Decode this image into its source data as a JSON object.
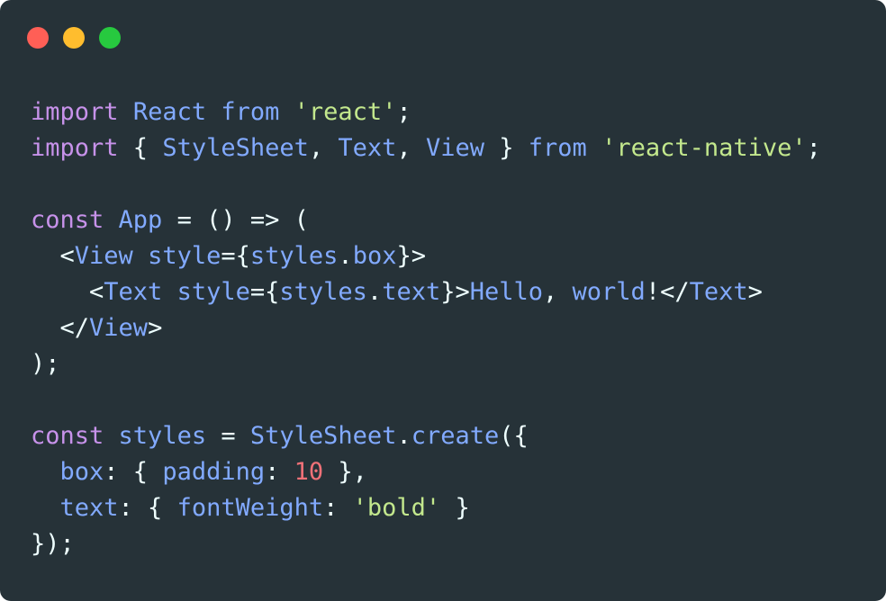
{
  "window": {
    "background": "#263238",
    "controls": [
      {
        "name": "close-button",
        "color": "#ff5f56"
      },
      {
        "name": "minimize-button",
        "color": "#ffbd2e"
      },
      {
        "name": "zoom-button",
        "color": "#27c93f"
      }
    ]
  },
  "theme": {
    "keyword": "#c792ea",
    "identifier": "#82aaff",
    "string": "#c3e88d",
    "number": "#f07178",
    "punctuation": "#eeffff"
  },
  "code": {
    "language": "jsx",
    "lines": [
      [
        [
          "keyword",
          "import"
        ],
        [
          "punct",
          " "
        ],
        [
          "ident",
          "React"
        ],
        [
          "punct",
          " "
        ],
        [
          "ident",
          "from"
        ],
        [
          "punct",
          " "
        ],
        [
          "string",
          "'react'"
        ],
        [
          "punct",
          ";"
        ]
      ],
      [
        [
          "keyword",
          "import"
        ],
        [
          "punct",
          " { "
        ],
        [
          "ident",
          "StyleSheet"
        ],
        [
          "punct",
          ", "
        ],
        [
          "ident",
          "Text"
        ],
        [
          "punct",
          ", "
        ],
        [
          "ident",
          "View"
        ],
        [
          "punct",
          " } "
        ],
        [
          "ident",
          "from"
        ],
        [
          "punct",
          " "
        ],
        [
          "string",
          "'react-native'"
        ],
        [
          "punct",
          ";"
        ]
      ],
      [],
      [
        [
          "keyword",
          "const"
        ],
        [
          "punct",
          " "
        ],
        [
          "ident",
          "App"
        ],
        [
          "punct",
          " = () => ("
        ]
      ],
      [
        [
          "punct",
          "  <"
        ],
        [
          "ident",
          "View"
        ],
        [
          "punct",
          " "
        ],
        [
          "ident",
          "style"
        ],
        [
          "punct",
          "={"
        ],
        [
          "ident",
          "styles"
        ],
        [
          "punct",
          "."
        ],
        [
          "ident",
          "box"
        ],
        [
          "punct",
          "}>"
        ]
      ],
      [
        [
          "punct",
          "    <"
        ],
        [
          "ident",
          "Text"
        ],
        [
          "punct",
          " "
        ],
        [
          "ident",
          "style"
        ],
        [
          "punct",
          "={"
        ],
        [
          "ident",
          "styles"
        ],
        [
          "punct",
          "."
        ],
        [
          "ident",
          "text"
        ],
        [
          "punct",
          "}>"
        ],
        [
          "ident",
          "Hello"
        ],
        [
          "punct",
          ", "
        ],
        [
          "ident",
          "world"
        ],
        [
          "punct",
          "!</"
        ],
        [
          "ident",
          "Text"
        ],
        [
          "punct",
          ">"
        ]
      ],
      [
        [
          "punct",
          "  </"
        ],
        [
          "ident",
          "View"
        ],
        [
          "punct",
          ">"
        ]
      ],
      [
        [
          "punct",
          ");"
        ]
      ],
      [],
      [
        [
          "keyword",
          "const"
        ],
        [
          "punct",
          " "
        ],
        [
          "ident",
          "styles"
        ],
        [
          "punct",
          " = "
        ],
        [
          "ident",
          "StyleSheet"
        ],
        [
          "punct",
          "."
        ],
        [
          "ident",
          "create"
        ],
        [
          "punct",
          "({"
        ]
      ],
      [
        [
          "punct",
          "  "
        ],
        [
          "ident",
          "box"
        ],
        [
          "punct",
          ": { "
        ],
        [
          "ident",
          "padding"
        ],
        [
          "punct",
          ": "
        ],
        [
          "number",
          "10"
        ],
        [
          "punct",
          " },"
        ]
      ],
      [
        [
          "punct",
          "  "
        ],
        [
          "ident",
          "text"
        ],
        [
          "punct",
          ": { "
        ],
        [
          "ident",
          "fontWeight"
        ],
        [
          "punct",
          ": "
        ],
        [
          "string",
          "'bold'"
        ],
        [
          "punct",
          " }"
        ]
      ],
      [
        [
          "punct",
          "});"
        ]
      ]
    ]
  }
}
